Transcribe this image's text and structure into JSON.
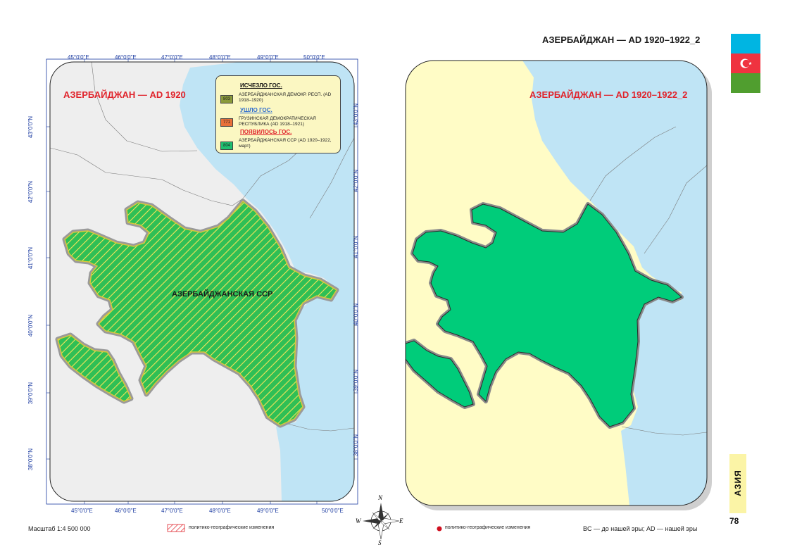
{
  "page": {
    "title": "АЗЕРБАЙДЖАН — AD 1920–1922_2",
    "region_tab": "АЗИЯ",
    "page_number": "78"
  },
  "colors": {
    "sea": "#bfe4f5",
    "land_gray": "#eeeeee",
    "land_yellow": "#fffcc6",
    "ssr_green": "#00cc7a",
    "hatch_red": "#e0242c",
    "title_red": "#e0242c",
    "flag_blue": "#00b5e2",
    "flag_red": "#ef3340",
    "flag_green": "#509e2f"
  },
  "left_map": {
    "title": "АЗЕРБАЙДЖАН — AD 1920",
    "state_label": "АЗЕРБАЙДЖАНСКАЯ ССР",
    "lon_labels": [
      "45°0'0\"E",
      "46°0'0\"E",
      "47°0'0\"E",
      "48°0'0\"E",
      "49°0'0\"E",
      "50°0'0\"E"
    ],
    "lat_labels": [
      "43°0'0\"N",
      "42°0'0\"N",
      "41°0'0\"N",
      "40°0'0\"N",
      "39°0'0\"N",
      "38°0'0\"N"
    ],
    "legend": {
      "disappeared_heading": "ИСЧЕЗЛО ГОС.",
      "disappeared_code": "803",
      "disappeared_text": "АЗЕРБАЙДЖАНСКАЯ ДЕМОКР. РЕСП. (AD 1918–1920)",
      "left_heading": "УШЛО ГОС.",
      "left_code": "771",
      "left_text": "ГРУЗИНСКАЯ ДЕМОКРАТИЧЕСКАЯ РЕСПУБЛИКА (AD 1918–1921)",
      "appeared_heading": "ПОЯВИЛОСЬ ГОС.",
      "appeared_code": "804",
      "appeared_text": "АЗЕРБАЙДЖАНСКАЯ ССР (AD 1920–1922, март)"
    }
  },
  "right_map": {
    "title": "АЗЕРБАЙДЖАН — AD 1920–1922_2"
  },
  "footer": {
    "scale": "Масштаб 1:4 500 000",
    "left_legend": "политико-географические изменения",
    "right_legend": "политико-географические изменения",
    "era_note": "BC — до нашей эры; AD — нашей эры"
  },
  "compass": {
    "north": "N",
    "south": "S",
    "east": "E",
    "west": "W"
  }
}
